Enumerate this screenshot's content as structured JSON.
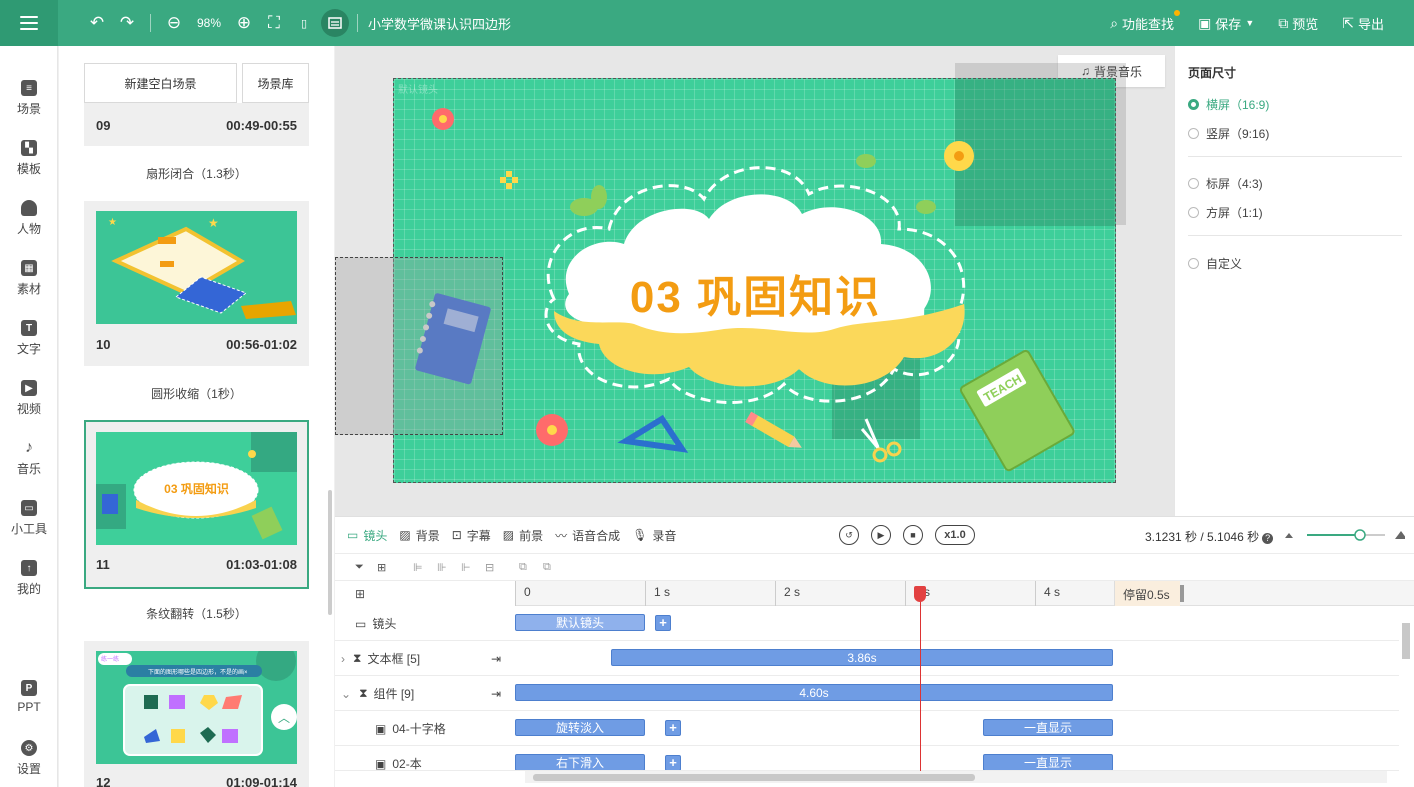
{
  "toolbar": {
    "zoom": "98%",
    "doc_title": "小学数学微课认识四边形",
    "find_label": "功能查找",
    "save_label": "保存",
    "preview_label": "预览",
    "export_label": "导出"
  },
  "leftnav": [
    "场景",
    "模板",
    "人物",
    "素材",
    "文字",
    "视频",
    "音乐",
    "小工具",
    "我的",
    "PPT",
    "设置"
  ],
  "scenes": {
    "new_blank": "新建空白场景",
    "library": "场景库",
    "cards": [
      {
        "num": "09",
        "time": "00:49-00:55",
        "transition": "扇形闭合（1.3秒）"
      },
      {
        "num": "10",
        "time": "00:56-01:02",
        "transition": "圆形收缩（1秒）"
      },
      {
        "num": "11",
        "time": "01:03-01:08",
        "transition": "条纹翻转（1.5秒）",
        "thumb_title": "03  巩固知识"
      },
      {
        "num": "12",
        "time": "01:09-01:14",
        "thumb_banner": "下面的图形哪些是四边形，不是的画×",
        "thumb_tag": "练一练"
      }
    ]
  },
  "canvas": {
    "bg_music": "背景音乐",
    "title": "03  巩固知识",
    "notebook_label": "TEACH",
    "corner_label": "默认镜头"
  },
  "props": {
    "title": "页面尺寸",
    "options": [
      {
        "label": "横屏（16:9)",
        "selected": true
      },
      {
        "label": "竖屏（9:16)",
        "selected": false
      },
      {
        "label": "标屏（4:3)",
        "selected": false
      },
      {
        "label": "方屏（1:1)",
        "selected": false
      },
      {
        "label": "自定义",
        "selected": false
      }
    ]
  },
  "timeline": {
    "tabs": [
      "镜头",
      "背景",
      "字幕",
      "前景",
      "语音合成",
      "录音"
    ],
    "speed": "x1.0",
    "time_readout": "3.1231 秒 / 5.1046 秒",
    "help": "?",
    "ruler": [
      "0",
      "1 s",
      "2 s",
      "3 s",
      "4 s"
    ],
    "pause": "停留0.5s",
    "tracks": [
      {
        "label": "镜头",
        "bar": "默认镜头"
      },
      {
        "label": "文本框 [5]",
        "bar": "3.86s"
      },
      {
        "label": "组件 [9]",
        "bar": "4.60s"
      },
      {
        "label": "04-十字格",
        "bar": "旋转淡入",
        "bar2": "一直显示"
      },
      {
        "label": "02-本",
        "bar": "右下滑入",
        "bar2": "一直显示"
      }
    ],
    "progress_fraction": 0.612
  },
  "colors": {
    "brand": "#3aa981",
    "stage": "#3ecf9a",
    "title_orange": "#f39c12",
    "bar_blue": "#6f9ce4",
    "playhead": "#e24141"
  }
}
